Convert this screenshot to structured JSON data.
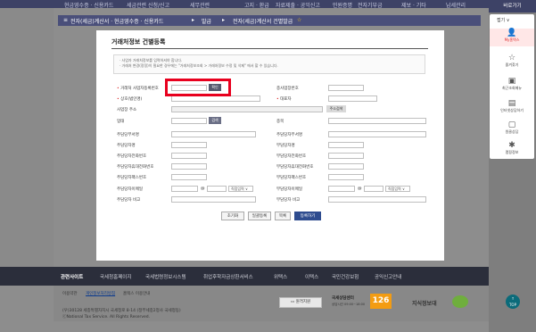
{
  "top_nav": [
    "현금영수증 · 신용카드",
    "세금관련 신청/신고",
    "세무관련",
    "고지 · 환급",
    "자료제출 · 공익신고",
    "민원증명",
    "전자기부금",
    "제보 · 기타",
    "납세관리"
  ],
  "sub_nav": {
    "breadcrumb": "전자(세금)계산서 · 현금영수증 · 신용카드",
    "arrow": "▸",
    "current": "발급",
    "menu": "전자(세금)계산서 건별발급"
  },
  "panel": {
    "title": "거래처정보 건별등록",
    "notices": [
      "· 사업자 거래처정보를 입력하셔야 합니다.",
      "· 거래처 변경(정정)이 필요한 경우에는 \"거래처정보조회 > 거래처정보 수정 및 삭제\" 에서 할 수 있습니다."
    ],
    "fields_top": {
      "biz_no": "거래처 사업자등록번호",
      "confirm_btn": "확인",
      "branch_no": "종사업장번호",
      "company": "상호(법인명)",
      "ceo": "대표자",
      "address": "사업장 주소",
      "addr_btn": "주소검색",
      "biz_type": "업태",
      "type_btn": "검색",
      "biz_item": "종목"
    },
    "manager_rows": [
      [
        "주담당부서명",
        "주담당자부서명"
      ],
      [
        "주담당자명",
        "부담당자명"
      ],
      [
        "주담당자전화번호",
        "부담당자전화번호"
      ],
      [
        "주담당자휴대전화번호",
        "부담당자휴대전화번호"
      ],
      [
        "주담당자팩스번호",
        "부담당자팩스번호"
      ],
      [
        "주담당자이메일",
        "부담당자이메일"
      ],
      [
        "주담당자 비고",
        "부담당자 비고"
      ]
    ],
    "email_at": "@",
    "email_select": "직접입력",
    "buttons": [
      "초기화",
      "일괄등록",
      "목록",
      "등록하기"
    ]
  },
  "footer": {
    "section": "관련사이트",
    "links": [
      "국세청홈페이지",
      "국세법령정보시스템",
      "취업후학자금상환서비스",
      "위택스",
      "이택스",
      "국민건강보험",
      "공익신고안내"
    ],
    "policy": [
      "이용약관",
      "개인정보처리방침",
      "홈텍스 이용안내"
    ],
    "address": "(우)30128 세종특별자치시 국세청로 8-14 (정부세종2청사 국세청동)",
    "copyright": "ⓒNational Tax Service. All Rights Reserved.",
    "remote_btn": "원격지원",
    "center": "국세상담센터",
    "center_hours": "상담시간 09:00~18:00",
    "phone": "126",
    "brand": "지식정보대"
  },
  "sidebar": {
    "header": "바로가기",
    "close": "접기 ∨",
    "items": [
      {
        "icon": "👤",
        "label": "My홈택스"
      },
      {
        "icon": "☆",
        "label": "즐겨찾기"
      },
      {
        "icon": "▣",
        "label": "최근조회메뉴"
      },
      {
        "icon": "▤",
        "label": "인터넷상담하기"
      },
      {
        "icon": "▢",
        "label": "원클상담"
      },
      {
        "icon": "✱",
        "label": "맵핑정보"
      }
    ],
    "top_btn": "TOP"
  }
}
